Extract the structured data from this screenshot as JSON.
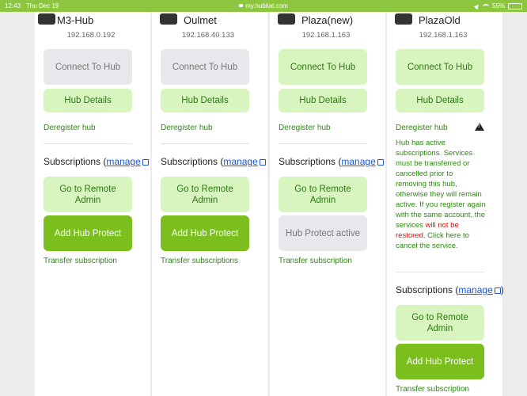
{
  "status_bar": {
    "time": "12:43",
    "date": "Thu Dec 19",
    "url": "my.hubitat.com",
    "battery": "55%"
  },
  "colors": {
    "accent_green": "#8cc63f",
    "button_light": "#d8f5bf",
    "button_dark": "#7bbf1e",
    "button_disabled": "#e8e8ec",
    "link_green": "#2c8a10",
    "warning_red": "#e01010",
    "manage_blue": "#1a56d6"
  },
  "hubs": [
    {
      "name": "M3-Hub",
      "ip": "192.168.0.192",
      "connect": "Connect To Hub",
      "details": "Hub Details",
      "deregister": "Deregister hub",
      "subs_label": "Subscriptions (",
      "manage": "manage",
      "remote": "Go to Remote Admin",
      "protect": "Add Hub Protect",
      "transfer": "Transfer subscription"
    },
    {
      "name": "Oulmet",
      "ip": "192.168.40.133",
      "connect": "Connect To Hub",
      "details": "Hub Details",
      "deregister": "Deregister hub",
      "subs_label": "Subscriptions (",
      "manage": "manage",
      "remote": "Go to Remote Admin",
      "protect": "Add Hub Protect",
      "transfer": "Transfer subscriptions"
    },
    {
      "name": "Plaza(new)",
      "ip": "192.168.1.163",
      "connect": "Connect To Hub",
      "details": "Hub Details",
      "deregister": "Deregister hub",
      "subs_label": "Subscriptions (",
      "manage": "manage",
      "remote": "Go to Remote Admin",
      "protect": "Hub Protect active",
      "transfer": "Transfer subscription"
    },
    {
      "name": "PlazaOld",
      "ip": "192.168.1.163",
      "connect": "Connect To Hub",
      "details": "Hub Details",
      "deregister": "Deregister hub",
      "notice_part1": "Hub has active subscriptions. Services must be transferred or cancelled prior to removing this hub, otherwise they will remain active. If you register again with the same account, the services ",
      "notice_red": "will not be restored",
      "notice_part2": ". Click here to cancel the service.",
      "subs_label": "Subscriptions (",
      "manage": "manage",
      "subs_close": ")",
      "remote": "Go to Remote Admin",
      "protect": "Add Hub Protect",
      "transfer": "Transfer subscription"
    }
  ]
}
